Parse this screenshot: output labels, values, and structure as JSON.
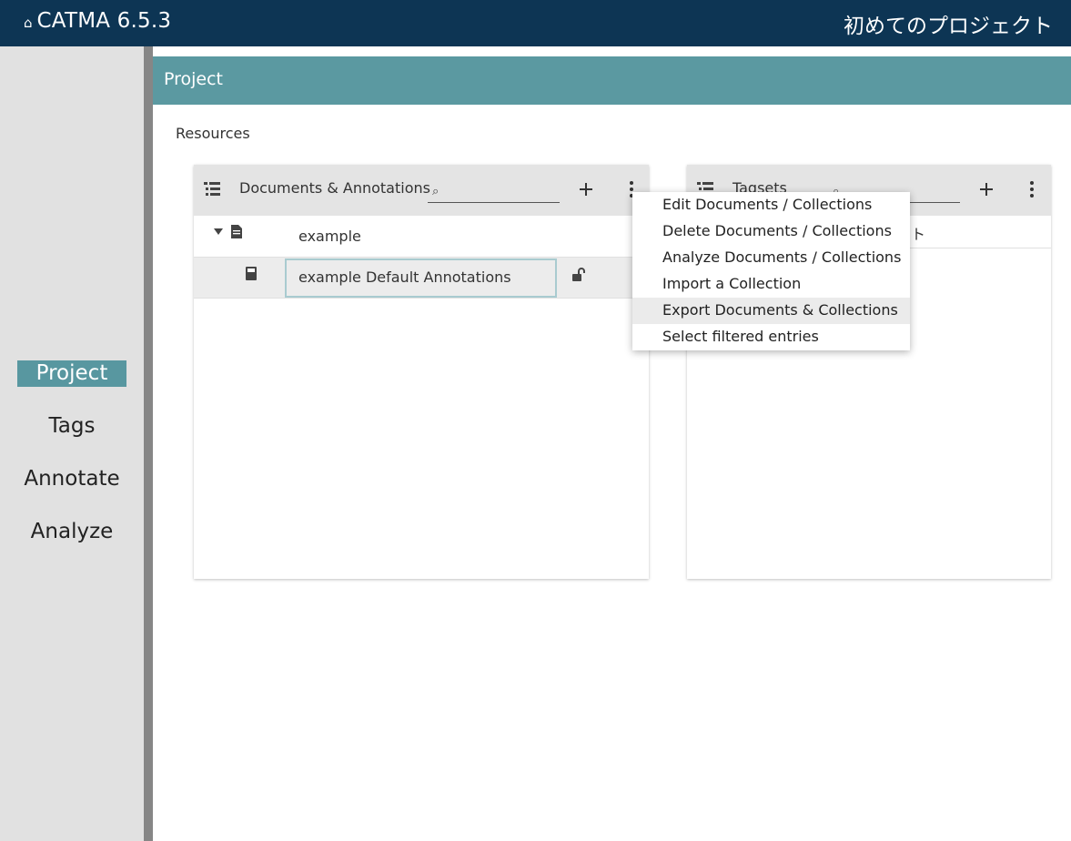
{
  "app": {
    "home_icon": "home-icon",
    "name": "CATMA 6.5.3",
    "project_title": "初めてのプロジェクト"
  },
  "sidebar": {
    "items": [
      {
        "label": "Project",
        "active": true
      },
      {
        "label": "Tags",
        "active": false
      },
      {
        "label": "Annotate",
        "active": false
      },
      {
        "label": "Analyze",
        "active": false
      }
    ]
  },
  "main": {
    "header_title": "Project",
    "section_label": "Resources"
  },
  "documents_panel": {
    "title": "Documents & Annotations",
    "search_placeholder": "",
    "add_icon": "plus-icon",
    "more_icon": "kebab-menu-icon",
    "rows": [
      {
        "name": "example",
        "icon": "document-icon",
        "expand_icon": "caret-down-icon"
      },
      {
        "name": "example Default Annotations",
        "icon": "collection-icon",
        "lock_icon": "unlocked-icon",
        "selected": true
      }
    ]
  },
  "tagsets_panel": {
    "title": "Tagsets",
    "search_placeholder": "",
    "add_icon": "plus-icon",
    "more_icon": "kebab-menu-icon",
    "rows": [
      {
        "name": "ット"
      }
    ]
  },
  "context_menu": {
    "items": [
      {
        "label": "Edit Documents / Collections",
        "hover": false
      },
      {
        "label": "Delete Documents / Collections",
        "hover": false
      },
      {
        "label": "Analyze Documents / Collections",
        "hover": false
      },
      {
        "label": "Import a Collection",
        "hover": false
      },
      {
        "label": "Export Documents & Collections",
        "hover": true
      },
      {
        "label": "Select filtered entries",
        "hover": false
      }
    ]
  },
  "colors": {
    "topbar": "#0d3554",
    "accent": "#5b99a1",
    "sidebar": "#e1e1e1",
    "panel_header": "#e4e4e4"
  }
}
